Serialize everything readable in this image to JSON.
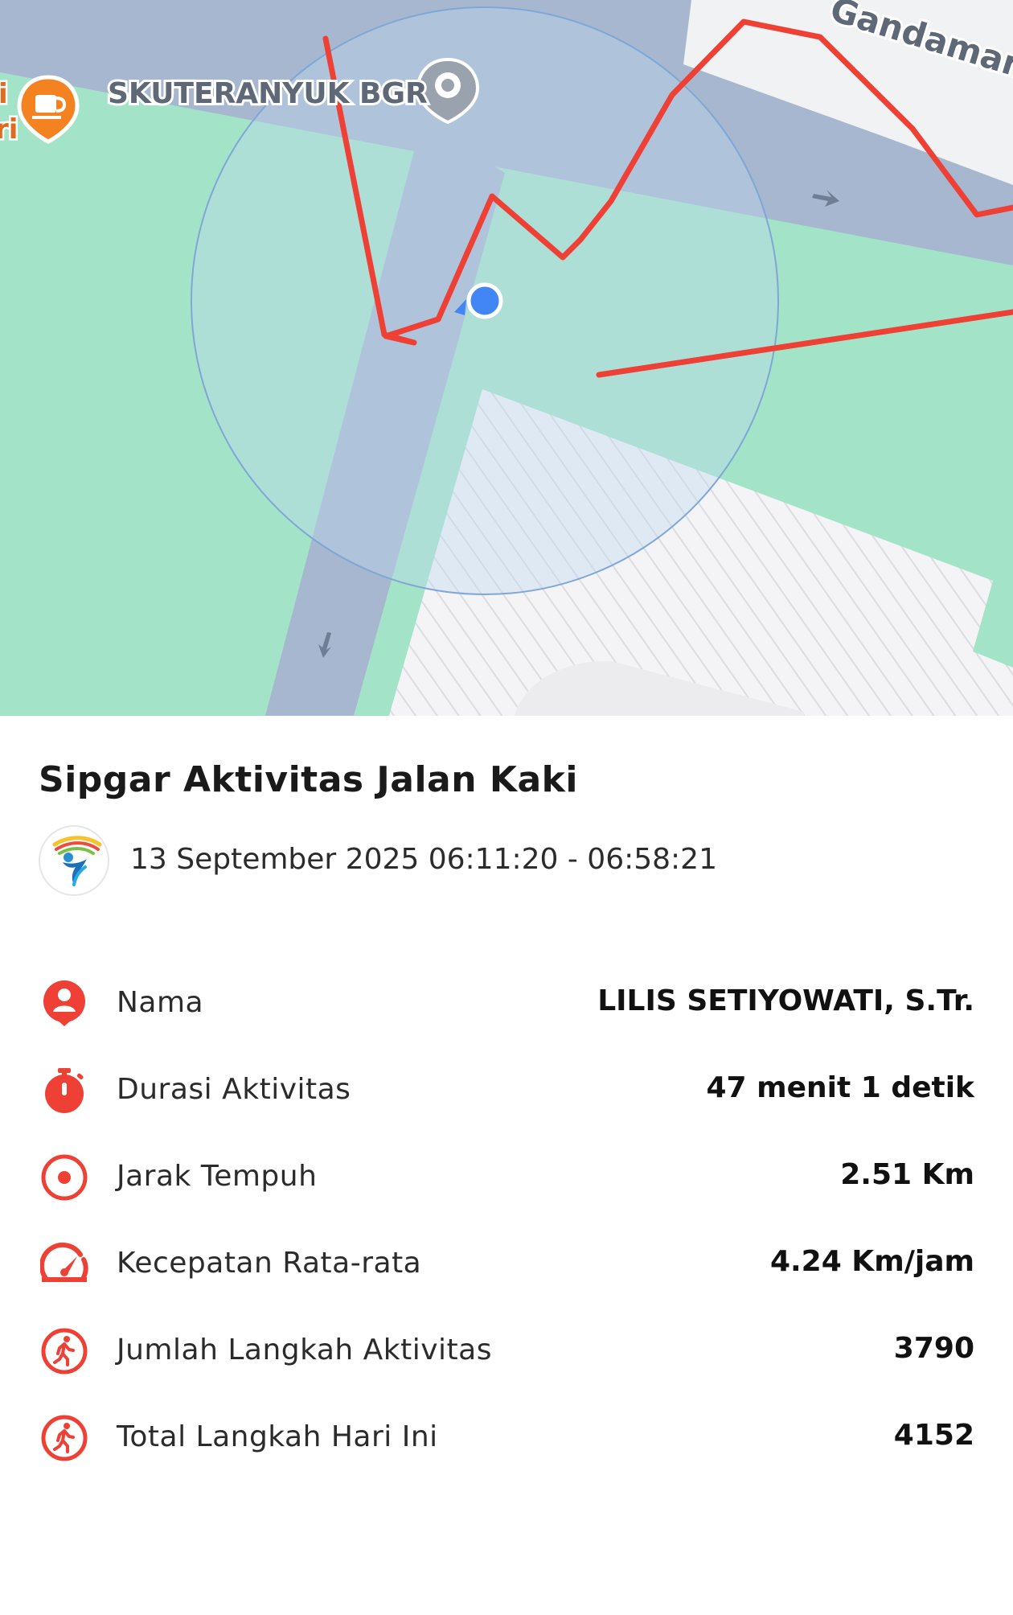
{
  "map": {
    "place_label": "SKUTERANYUK BGR",
    "street_label": "Gandamana",
    "place_icon": "location-pin-icon",
    "cafe_icon": "coffee-cup-icon",
    "left_edge_label_1": "i",
    "left_edge_label_2": "ri",
    "route_color": "#ee4035",
    "current_location_color": "#4285f4",
    "park_color": "#a3e4c8",
    "road_color": "#a7b7cf"
  },
  "card": {
    "title": "Sipgar Aktivitas Jalan Kaki",
    "datetime": "13 September 2025 06:11:20 - 06:58:21",
    "logo_icon": "sipgar-logo",
    "accent_color": "#ee4035"
  },
  "stats": [
    {
      "icon": "user-icon",
      "label": "Nama",
      "value": "LILIS SETIYOWATI, S.Tr."
    },
    {
      "icon": "stopwatch-icon",
      "label": "Durasi Aktivitas",
      "value": "47 menit 1 detik"
    },
    {
      "icon": "target-icon",
      "label": "Jarak Tempuh",
      "value": "2.51 Km"
    },
    {
      "icon": "speedometer-icon",
      "label": "Kecepatan Rata-rata",
      "value": "4.24 Km/jam"
    },
    {
      "icon": "walking-icon",
      "label": "Jumlah Langkah Aktivitas",
      "value": "3790"
    },
    {
      "icon": "walking-icon",
      "label": "Total Langkah Hari Ini",
      "value": "4152"
    }
  ]
}
